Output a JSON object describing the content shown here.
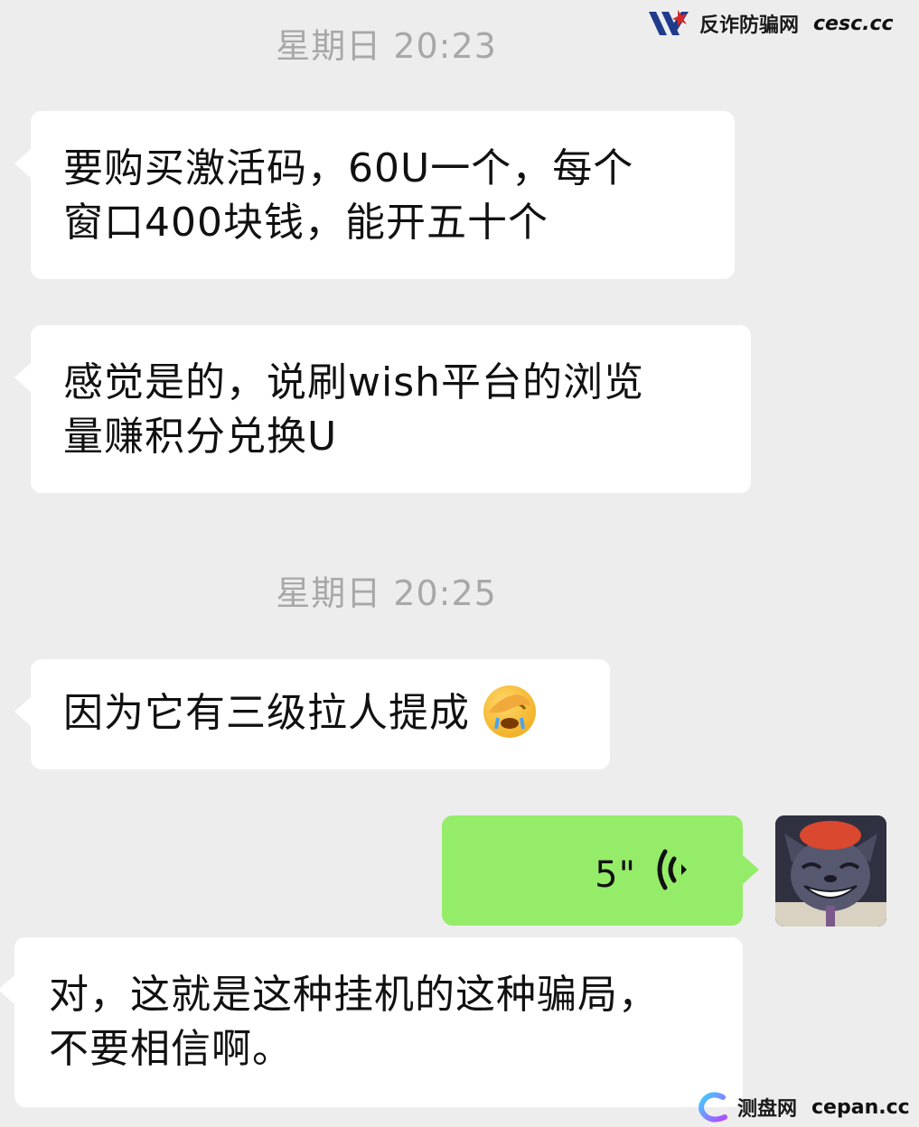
{
  "watermarks": {
    "top_brand": "反诈防骗网",
    "top_domain": "cesc.cc",
    "bottom_brand": "测盘网",
    "bottom_domain": "cepan.cc"
  },
  "messages": [
    {
      "type": "timestamp",
      "text": "星期日 20:23"
    },
    {
      "type": "incoming",
      "lines": [
        "要购买激活码，60U一个，每个",
        "窗口400块钱，能开五十个"
      ]
    },
    {
      "type": "incoming",
      "lines": [
        "感觉是的，说刷wish平台的浏览",
        "量赚积分兑换U"
      ]
    },
    {
      "type": "timestamp",
      "text": "星期日 20:25"
    },
    {
      "type": "incoming",
      "lines": [
        "因为它有三级拉人提成"
      ],
      "emoji": "facepalm-emoji"
    },
    {
      "type": "outgoing-voice",
      "duration": "5\"",
      "icon": "voice-wave-icon"
    },
    {
      "type": "incoming",
      "lines": [
        "对，这就是这种挂机的这种骗局，",
        "不要相信啊。"
      ]
    }
  ],
  "avatar": {
    "icon": "cartoon-wolf-avatar"
  },
  "colors": {
    "background": "#ededed",
    "incoming_bubble": "#ffffff",
    "outgoing_bubble": "#95ec69",
    "timestamp": "#a8a8a8"
  }
}
